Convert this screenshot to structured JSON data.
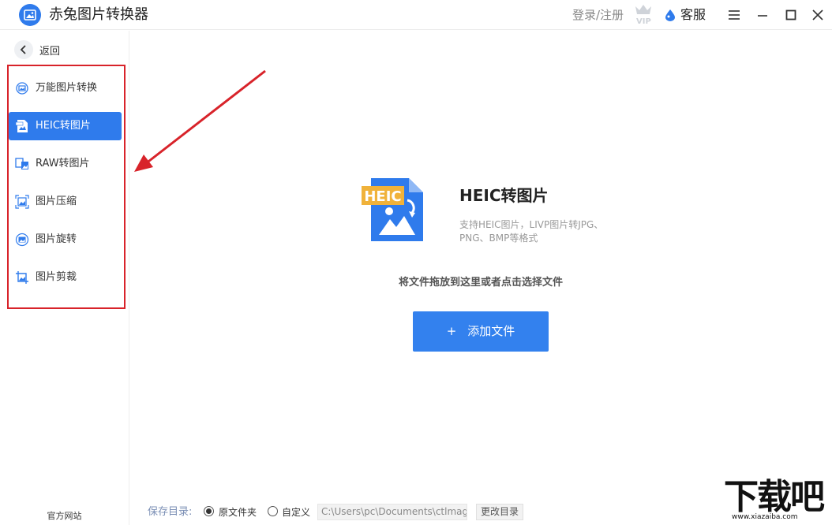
{
  "app": {
    "title": "赤兔图片转换器",
    "login_label": "登录/注册",
    "vip_label": "VIP",
    "support_label": "客服"
  },
  "sidebar": {
    "back_label": "返回",
    "items": [
      {
        "label": "万能图片转换",
        "icon": "convert-icon",
        "active": false
      },
      {
        "label": "HEIC转图片",
        "icon": "heic-icon",
        "active": true
      },
      {
        "label": "RAW转图片",
        "icon": "raw-icon",
        "active": false
      },
      {
        "label": "图片压缩",
        "icon": "compress-icon",
        "active": false
      },
      {
        "label": "图片旋转",
        "icon": "rotate-icon",
        "active": false
      },
      {
        "label": "图片剪裁",
        "icon": "crop-icon",
        "active": false
      }
    ],
    "official_site": "官方网站"
  },
  "main": {
    "badge_text": "HEIC",
    "feature_title": "HEIC转图片",
    "feature_desc": "支持HEIC图片，LIVP图片转JPG、PNG、BMP等格式",
    "drop_hint": "将文件拖放到这里或者点击选择文件",
    "add_button_plus": "+",
    "add_button_label": "添加文件"
  },
  "footer": {
    "save_label": "保存目录:",
    "option_original": "原文件夹",
    "option_custom": "自定义",
    "selected_option": "原文件夹",
    "path_value": "C:\\Users\\pc\\Documents\\ctlmag",
    "change_dir_label": "更改目录"
  },
  "watermark": {
    "text": "下载吧",
    "url": "www.xiazaiba.com"
  },
  "colors": {
    "accent": "#2f7bec",
    "highlight_frame": "#d8232a",
    "badge": "#f0b23a"
  }
}
